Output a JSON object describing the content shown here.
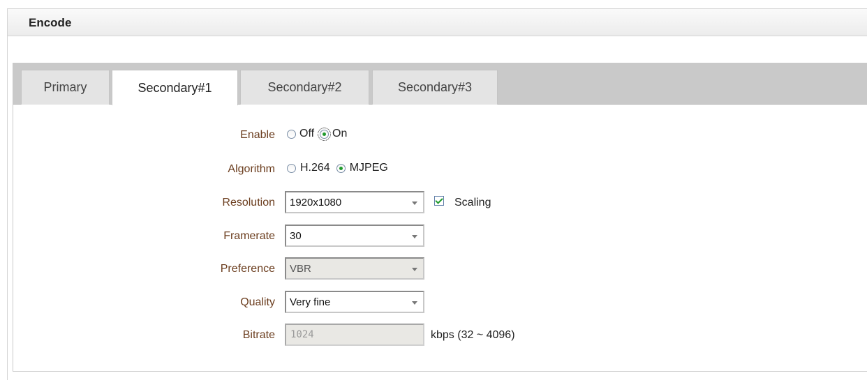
{
  "header": {
    "title": "Encode"
  },
  "tabs": [
    {
      "label": "Primary",
      "active": false
    },
    {
      "label": "Secondary#1",
      "active": true
    },
    {
      "label": "Secondary#2",
      "active": false
    },
    {
      "label": "Secondary#3",
      "active": false
    }
  ],
  "form": {
    "enable": {
      "label": "Enable",
      "options": [
        "Off",
        "On"
      ],
      "selected": "On"
    },
    "algorithm": {
      "label": "Algorithm",
      "options": [
        "H.264",
        "MJPEG"
      ],
      "selected": "MJPEG"
    },
    "resolution": {
      "label": "Resolution",
      "value": "1920x1080",
      "scaling_label": "Scaling",
      "scaling_checked": true
    },
    "framerate": {
      "label": "Framerate",
      "value": "30"
    },
    "preference": {
      "label": "Preference",
      "value": "VBR",
      "disabled": true
    },
    "quality": {
      "label": "Quality",
      "value": "Very fine"
    },
    "bitrate": {
      "label": "Bitrate",
      "value": "1024",
      "disabled": true,
      "unit": "kbps (32 ~ 4096)"
    }
  },
  "colors": {
    "label_text": "#6b3d1e",
    "tabbar_bg": "#c9c9c9",
    "radio_dot": "#1f9a2b"
  },
  "icons": {
    "radio_checked": "radio-checked-icon",
    "radio_unchecked": "radio-unchecked-icon",
    "dropdown": "chevron-down-icon",
    "checkbox_checked": "checkmark-icon"
  }
}
